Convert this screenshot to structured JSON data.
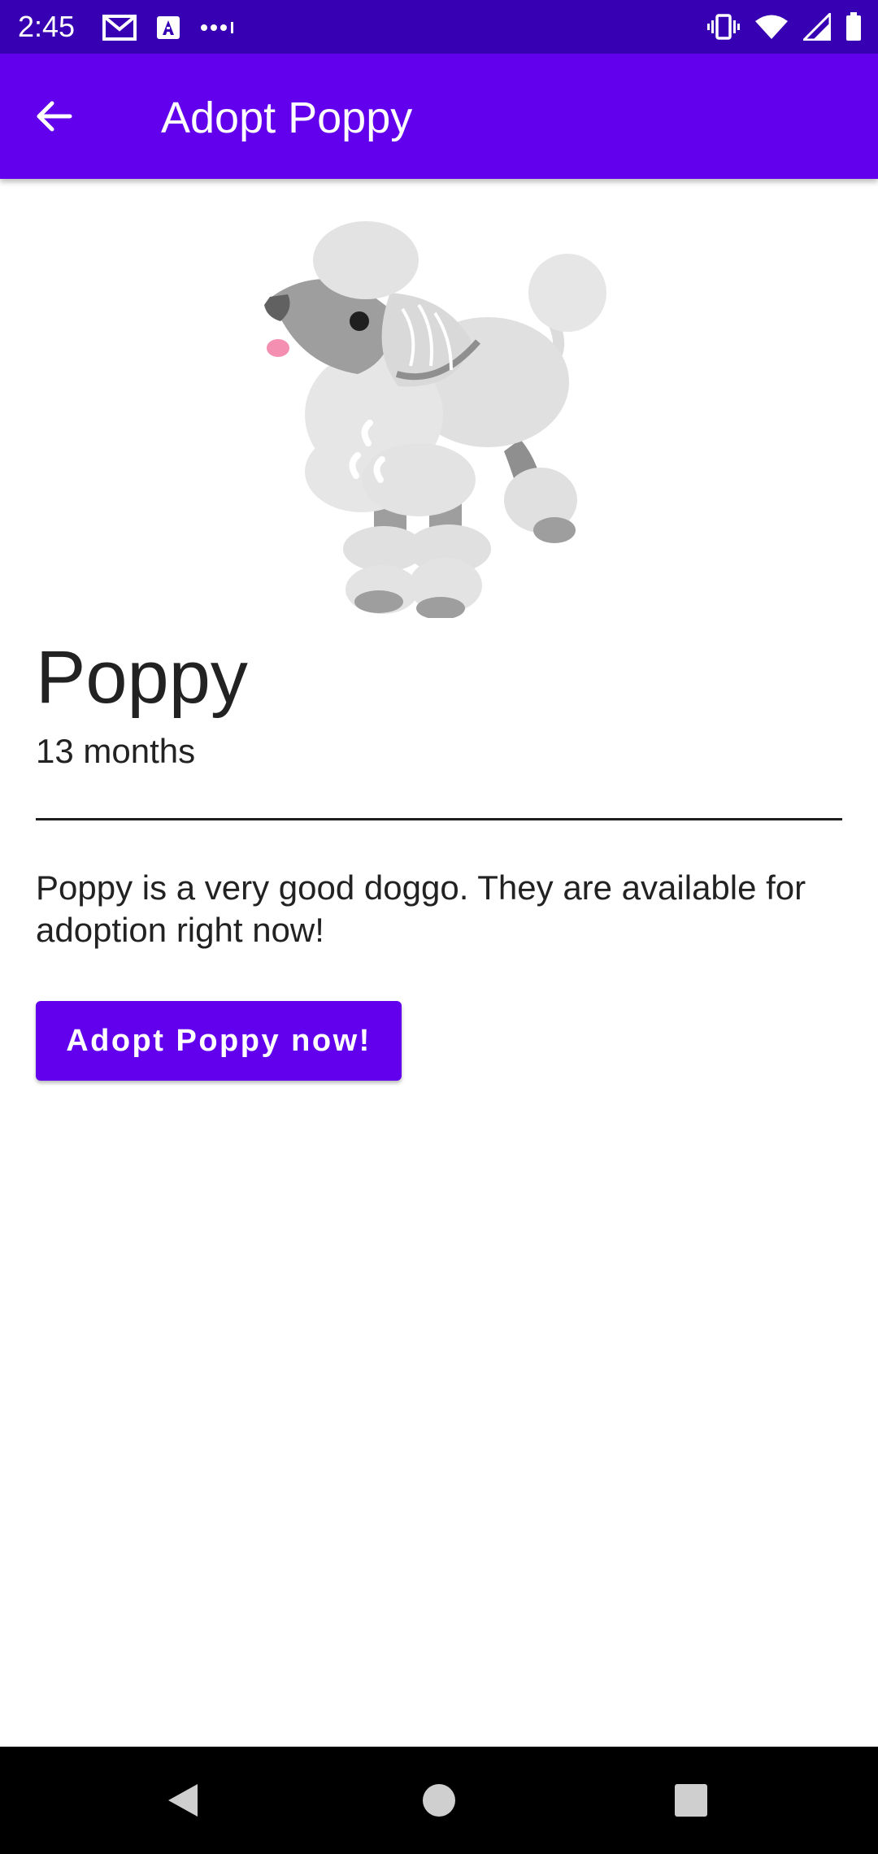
{
  "status_bar": {
    "time": "2:45",
    "icons": [
      "gmail-icon",
      "accessibility-icon",
      "more-notifications-icon",
      "vibrate-icon",
      "wifi-icon",
      "signal-icon",
      "battery-icon"
    ]
  },
  "app_bar": {
    "title": "Adopt Poppy",
    "back_icon": "arrow-back-icon"
  },
  "dog": {
    "name": "Poppy",
    "age": "13 months",
    "description": "Poppy is a very good doggo. They are available for adoption right now!",
    "image": "poodle-illustration"
  },
  "action": {
    "adopt_label": "Adopt Poppy now!"
  },
  "colors": {
    "primary": "#6200ee",
    "primary_dark": "#3700b3",
    "text": "#222222"
  },
  "nav_bar": {
    "icons": [
      "back-triangle-icon",
      "home-circle-icon",
      "recents-square-icon"
    ]
  }
}
